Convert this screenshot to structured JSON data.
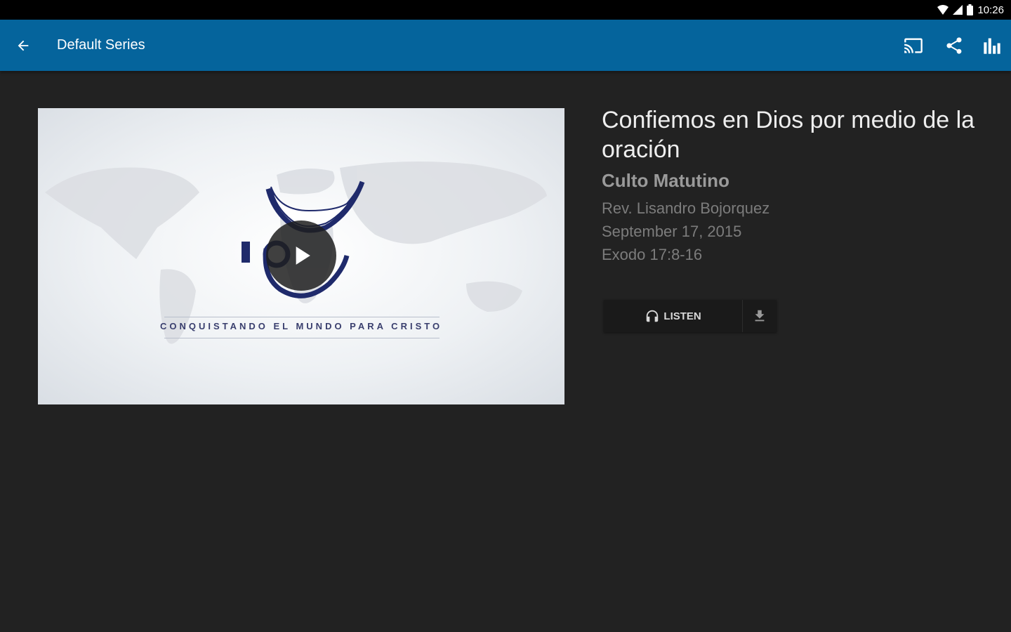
{
  "status_bar": {
    "time": "10:26",
    "icons": [
      "wifi-icon",
      "signal-icon",
      "battery-icon"
    ]
  },
  "toolbar": {
    "title": "Default Series",
    "back_icon": "arrow-left-icon",
    "actions": [
      "cast-icon",
      "share-icon",
      "chart-icon"
    ],
    "color": "#05649c"
  },
  "media": {
    "tagline": "CONQUISTANDO EL MUNDO PARA CRISTO",
    "play_icon": "play-icon"
  },
  "sermon": {
    "title": "Confiemos en Dios por medio de la oración",
    "series": "Culto Matutino",
    "speaker": "Rev. Lisandro Bojorquez",
    "date": "September 17, 2015",
    "passage": "Exodo 17:8-16"
  },
  "actions": {
    "listen_label": "LISTEN",
    "listen_icon": "headphones-icon",
    "download_icon": "download-icon"
  },
  "colors": {
    "background": "#222222",
    "toolbar": "#05649c",
    "status_bar": "#000000"
  }
}
